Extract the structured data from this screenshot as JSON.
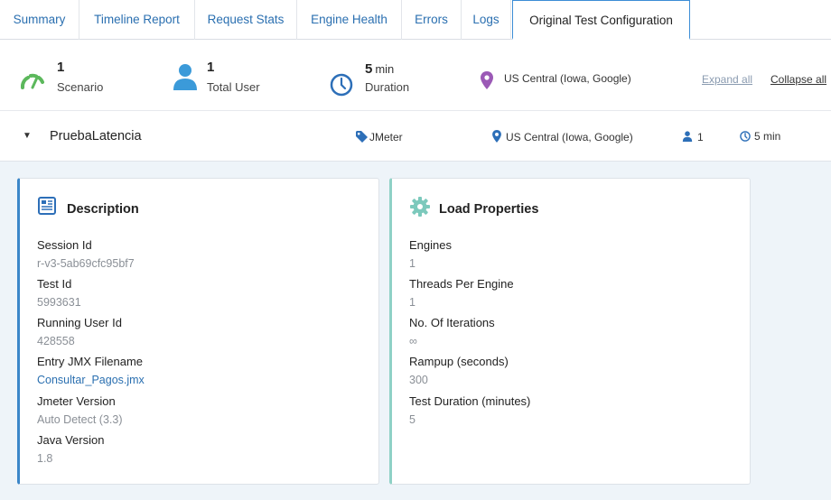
{
  "tabs": [
    {
      "label": "Summary"
    },
    {
      "label": "Timeline Report"
    },
    {
      "label": "Request Stats"
    },
    {
      "label": "Engine Health"
    },
    {
      "label": "Errors"
    },
    {
      "label": "Logs"
    },
    {
      "label": "Original Test Configuration",
      "active": true
    }
  ],
  "summary": {
    "scenarios": {
      "value": "1",
      "label": "Scenario",
      "icon": "gauge-icon"
    },
    "users": {
      "value": "1",
      "label": "Total User",
      "icon": "user-icon"
    },
    "duration": {
      "value": "5",
      "unit": "min",
      "label": "Duration",
      "icon": "clock-icon"
    },
    "location": {
      "text": "US Central (Iowa, Google)",
      "icon": "location-pin-icon"
    },
    "expand_all": "Expand all",
    "collapse_all": "Collapse all"
  },
  "scenario": {
    "name": "PruebaLatencia",
    "engine": "JMeter",
    "location": "US Central (Iowa, Google)",
    "users": "1",
    "duration": "5 min"
  },
  "description": {
    "title": "Description",
    "fields": [
      {
        "label": "Session Id",
        "value": "r-v3-5ab69cfc95bf7"
      },
      {
        "label": "Test Id",
        "value": "5993631"
      },
      {
        "label": "Running User Id",
        "value": "428558"
      },
      {
        "label": "Entry JMX Filename",
        "value": "Consultar_Pagos.jmx"
      },
      {
        "label": "Jmeter Version",
        "value": "Auto Detect (3.3)"
      },
      {
        "label": "Java Version",
        "value": "1.8"
      }
    ]
  },
  "load_properties": {
    "title": "Load Properties",
    "fields": [
      {
        "label": "Engines",
        "value": "1"
      },
      {
        "label": "Threads Per Engine",
        "value": "1"
      },
      {
        "label": "No. Of Iterations",
        "value": "∞"
      },
      {
        "label": "Rampup (seconds)",
        "value": "300"
      },
      {
        "label": "Test Duration (minutes)",
        "value": "5"
      }
    ]
  },
  "colors": {
    "link": "#2a6fb0",
    "accent_blue": "#3b86c8",
    "accent_teal": "#8fd1c6",
    "gauge_green": "#5cb85c",
    "location_purple": "#9b59b6",
    "user_blue": "#3b9ad9"
  }
}
